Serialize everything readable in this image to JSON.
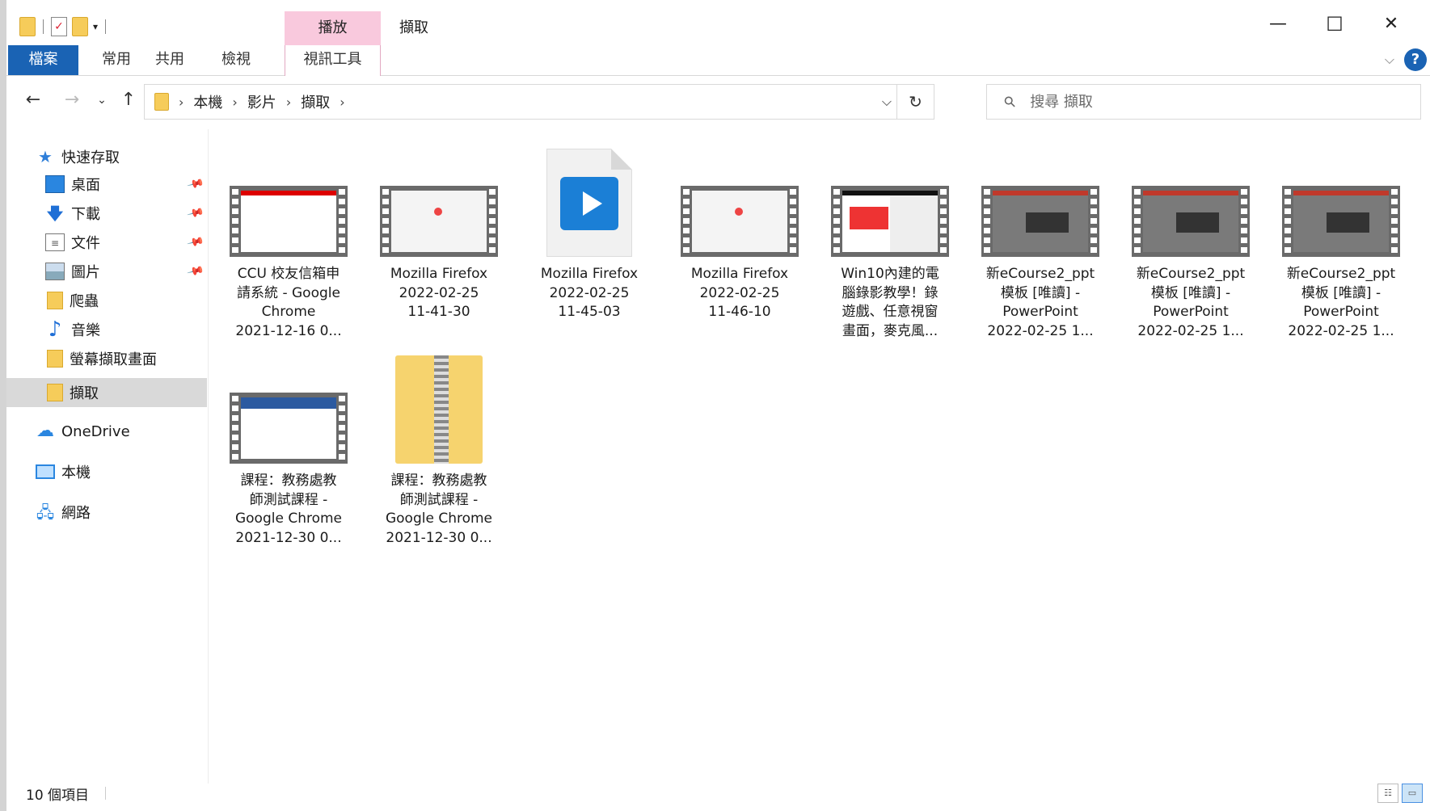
{
  "window": {
    "title": "擷取",
    "context_tab": "播放",
    "controls": {
      "minimize": "—",
      "maximize": "☐",
      "close": "✕"
    }
  },
  "ribbon": {
    "tabs": [
      "檔案",
      "常用",
      "共用",
      "檢視",
      "視訊工具"
    ],
    "help": "?"
  },
  "nav": {
    "breadcrumb": [
      "本機",
      "影片",
      "擷取"
    ],
    "search_placeholder": "搜尋 擷取"
  },
  "sidebar": {
    "items": [
      {
        "label": "快速存取",
        "icon": "star-icon"
      },
      {
        "label": "桌面",
        "icon": "desktop-icon",
        "pinned": true
      },
      {
        "label": "下載",
        "icon": "download-icon",
        "pinned": true
      },
      {
        "label": "文件",
        "icon": "document-icon",
        "pinned": true
      },
      {
        "label": "圖片",
        "icon": "pictures-icon",
        "pinned": true
      },
      {
        "label": "爬蟲",
        "icon": "folder-icon"
      },
      {
        "label": "音樂",
        "icon": "music-icon"
      },
      {
        "label": "螢幕擷取畫面",
        "icon": "folder-icon"
      },
      {
        "label": "擷取",
        "icon": "folder-icon",
        "selected": true
      },
      {
        "label": "OneDrive",
        "icon": "onedrive-icon"
      },
      {
        "label": "本機",
        "icon": "computer-icon"
      },
      {
        "label": "網路",
        "icon": "network-icon"
      }
    ]
  },
  "files": [
    {
      "lines": [
        "CCU 校友信箱申",
        "請系統 - Google",
        "Chrome",
        "2021-12-16 0..."
      ],
      "type": "video",
      "thumb": "ccu"
    },
    {
      "lines": [
        "Mozilla Firefox",
        "2022-02-25",
        "11-41-30"
      ],
      "type": "video",
      "thumb": "ffx"
    },
    {
      "lines": [
        "Mozilla Firefox",
        "2022-02-25",
        "11-45-03"
      ],
      "type": "video-file-icon",
      "thumb": ""
    },
    {
      "lines": [
        "Mozilla Firefox",
        "2022-02-25",
        "11-46-10"
      ],
      "type": "video",
      "thumb": "ffx"
    },
    {
      "lines": [
        "Win10內建的電",
        "腦錄影教學！錄",
        "遊戲、任意視窗",
        "畫面，麥克風..."
      ],
      "type": "video",
      "thumb": "news"
    },
    {
      "lines": [
        "新eCourse2_ppt",
        "模板 [唯讀] -",
        "PowerPoint",
        "2022-02-25 1..."
      ],
      "type": "video",
      "thumb": "ppt"
    },
    {
      "lines": [
        "新eCourse2_ppt",
        "模板 [唯讀] -",
        "PowerPoint",
        "2022-02-25 1..."
      ],
      "type": "video",
      "thumb": "ppt"
    },
    {
      "lines": [
        "新eCourse2_ppt",
        "模板 [唯讀] -",
        "PowerPoint",
        "2022-02-25 1..."
      ],
      "type": "video",
      "thumb": "ppt"
    },
    {
      "lines": [
        "課程：教務處教",
        "師測試課程 -",
        "Google Chrome",
        "2021-12-30 0..."
      ],
      "type": "video",
      "thumb": "chrome"
    },
    {
      "lines": [
        "課程：教務處教",
        "師測試課程 -",
        "Google Chrome",
        "2021-12-30 0..."
      ],
      "type": "zip",
      "thumb": ""
    }
  ],
  "status": {
    "count": "10 個項目"
  }
}
